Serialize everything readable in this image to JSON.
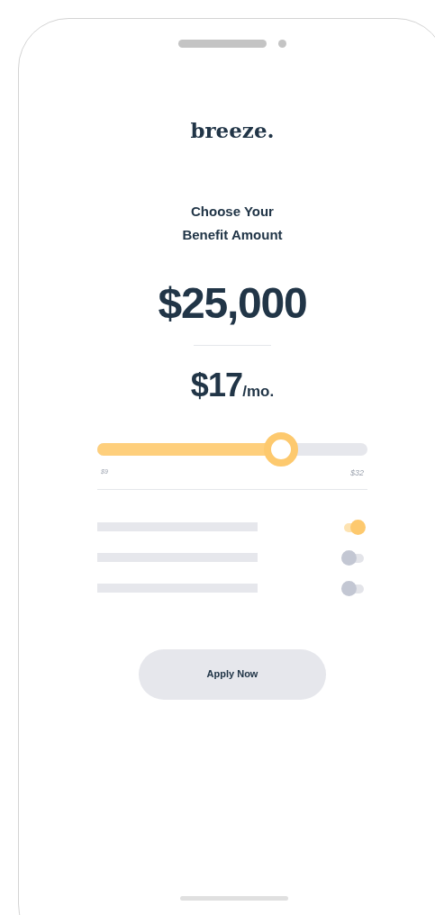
{
  "logo": "breeze.",
  "heading": [
    "Choose Your",
    "Benefit Amount"
  ],
  "benefit_amount": "$25,000",
  "price": {
    "amount": "$17",
    "unit": "/mo."
  },
  "slider": {
    "level": 0.68,
    "min_label": "$9",
    "max_label": "$32"
  },
  "options": [
    {
      "on": true
    },
    {
      "on": false
    },
    {
      "on": false
    }
  ],
  "button": "Apply Now"
}
